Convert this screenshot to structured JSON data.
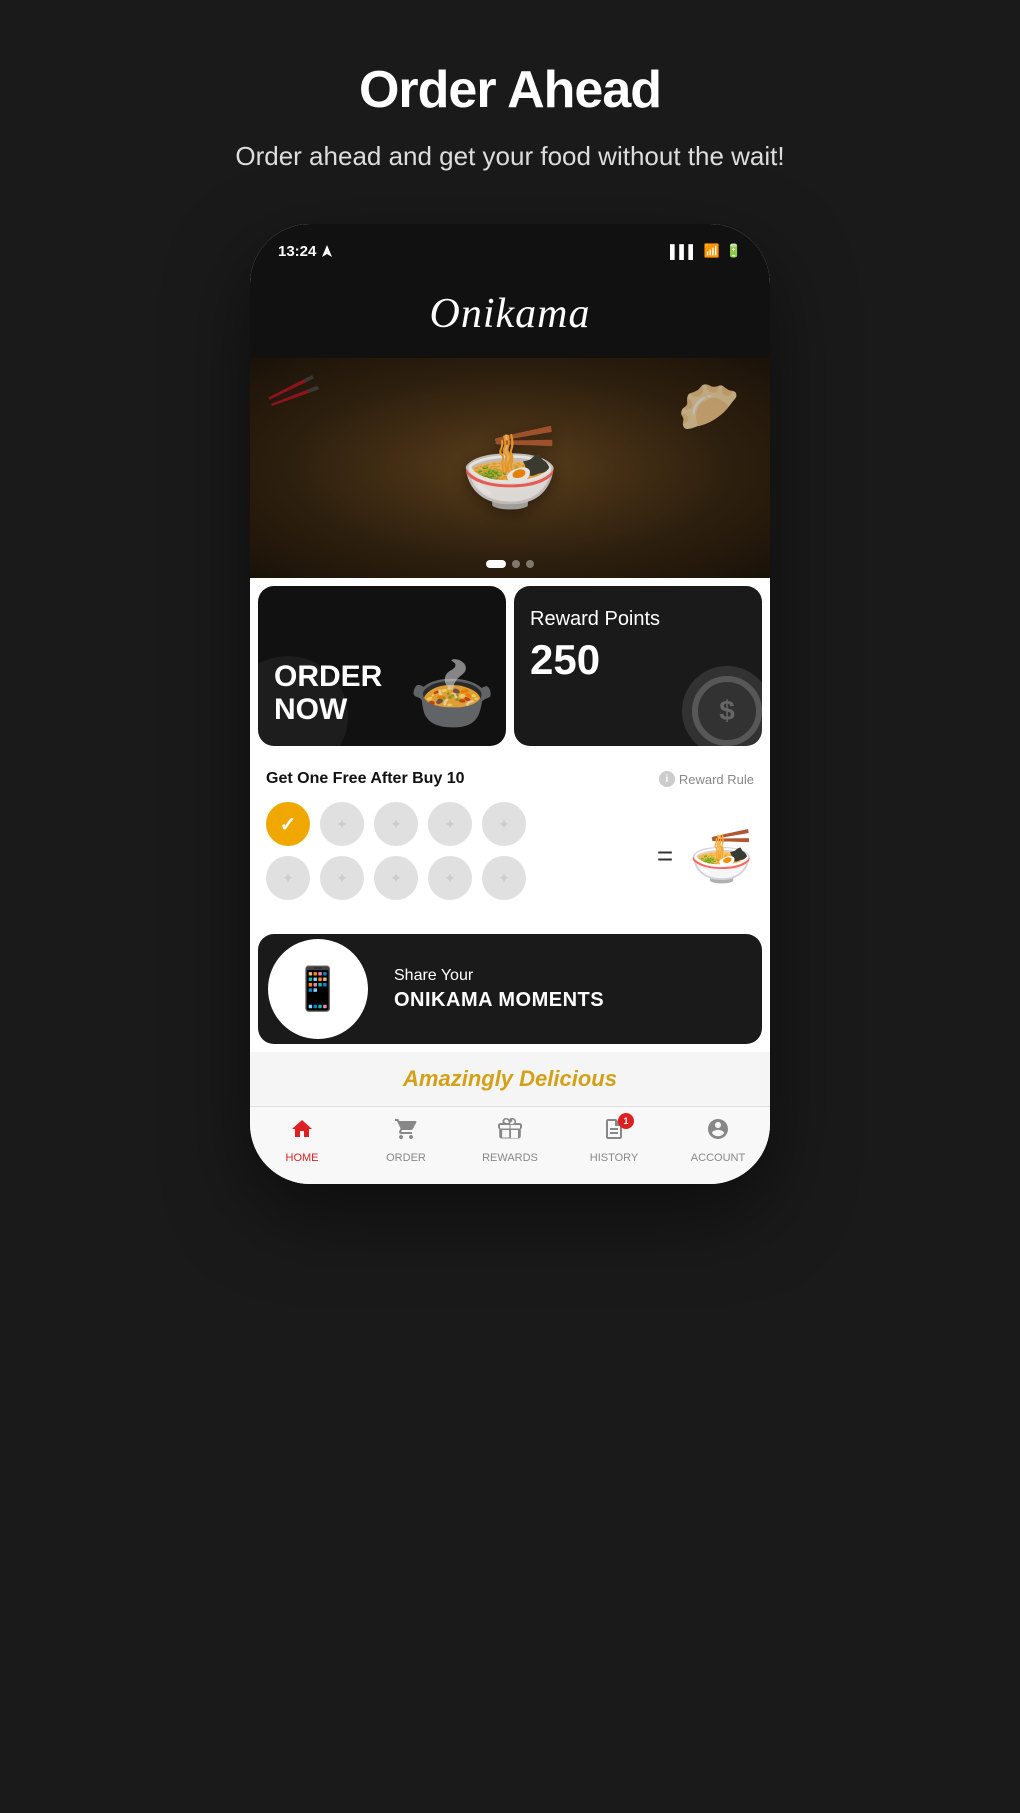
{
  "page": {
    "title": "Order Ahead",
    "subtitle": "Order ahead and get your food without the wait!"
  },
  "phone": {
    "status_time": "13:24",
    "app_name": "Onikama"
  },
  "hero": {
    "dots": [
      "active",
      "inactive",
      "inactive"
    ]
  },
  "cards": {
    "order_now": {
      "label_line1": "ORDER",
      "label_line2": "NOW"
    },
    "reward": {
      "label": "Reward Points",
      "points": "250"
    }
  },
  "loyalty": {
    "title": "Get One Free After Buy 10",
    "rule_label": "Reward Rule",
    "stamps": [
      {
        "filled": true
      },
      {
        "filled": false
      },
      {
        "filled": false
      },
      {
        "filled": false
      },
      {
        "filled": false
      },
      {
        "filled": false
      },
      {
        "filled": false
      },
      {
        "filled": false
      },
      {
        "filled": false
      },
      {
        "filled": false
      }
    ]
  },
  "share_banner": {
    "top": "Share Your",
    "bottom": "ONIKAMA MOMENTS"
  },
  "teaser": {
    "text": "Amazingly Delicious"
  },
  "nav": {
    "items": [
      {
        "label": "HOME",
        "active": true,
        "icon": "home"
      },
      {
        "label": "ORDER",
        "active": false,
        "icon": "bag"
      },
      {
        "label": "REWARDS",
        "active": false,
        "icon": "gift"
      },
      {
        "label": "HISTORY",
        "active": false,
        "icon": "receipt",
        "badge": "1"
      },
      {
        "label": "ACCOUNT",
        "active": false,
        "icon": "person"
      }
    ]
  }
}
